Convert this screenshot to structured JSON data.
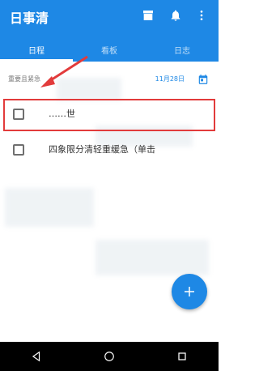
{
  "appbar": {
    "title": "日事清"
  },
  "tabs": [
    {
      "label": "日程",
      "active": true
    },
    {
      "label": "看板",
      "active": false
    },
    {
      "label": "日志",
      "active": false
    }
  ],
  "section": {
    "label": "重要且紧急",
    "date": "11月28日"
  },
  "tasks": [
    {
      "text": "……世"
    },
    {
      "text": "四象限分清轻重缓急（单击"
    }
  ],
  "colors": {
    "primary": "#1e88e5",
    "highlight": "#e23b3b"
  },
  "icons": {
    "archive": "archive-icon",
    "bell": "bell-icon",
    "more": "more-vert-icon",
    "calendar": "calendar-icon",
    "fab": "add-icon"
  }
}
